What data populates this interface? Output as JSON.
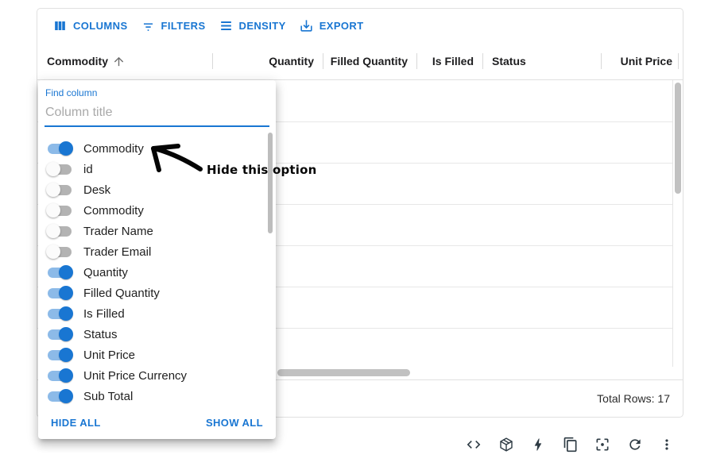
{
  "colors": {
    "primary": "#1976d2",
    "switch_on_track": "#8cbae8",
    "switch_off_track": "#b3b3b3",
    "border": "#e0e0e0",
    "scrollbar_thumb": "#c1c1c1",
    "bottom_icon": "#2e3b44",
    "annotation": "#050505"
  },
  "toolbar": {
    "buttons": [
      {
        "label": "COLUMNS",
        "icon": "view-columns-icon"
      },
      {
        "label": "FILTERS",
        "icon": "filter-list-icon"
      },
      {
        "label": "DENSITY",
        "icon": "density-icon"
      },
      {
        "label": "EXPORT",
        "icon": "download-icon"
      }
    ]
  },
  "grid": {
    "columns": [
      {
        "label": "Commodity",
        "sort": "asc"
      },
      {
        "label": "Quantity"
      },
      {
        "label": "Filled Quantity"
      },
      {
        "label": "Is Filled"
      },
      {
        "label": "Status"
      },
      {
        "label": "Unit Price"
      }
    ],
    "footer": {
      "total_rows": "Total Rows: 17"
    }
  },
  "columns_panel": {
    "search_label": "Find column",
    "search_placeholder": "Column title",
    "search_value": "",
    "items": [
      {
        "label": "Commodity",
        "on": true
      },
      {
        "label": "id",
        "on": false
      },
      {
        "label": "Desk",
        "on": false
      },
      {
        "label": "Commodity",
        "on": false
      },
      {
        "label": "Trader Name",
        "on": false
      },
      {
        "label": "Trader Email",
        "on": false
      },
      {
        "label": "Quantity",
        "on": true
      },
      {
        "label": "Filled Quantity",
        "on": true
      },
      {
        "label": "Is Filled",
        "on": true
      },
      {
        "label": "Status",
        "on": true
      },
      {
        "label": "Unit Price",
        "on": true
      },
      {
        "label": "Unit Price Currency",
        "on": true
      },
      {
        "label": "Sub Total",
        "on": true
      }
    ],
    "hide_all_label": "HIDE ALL",
    "show_all_label": "SHOW ALL"
  },
  "annotation": {
    "text": "Hide this option"
  },
  "bottom_toolbar": {
    "icons": [
      "code",
      "sandbox-cube",
      "lightning",
      "copy",
      "center-focus",
      "refresh",
      "more-vertical"
    ]
  }
}
